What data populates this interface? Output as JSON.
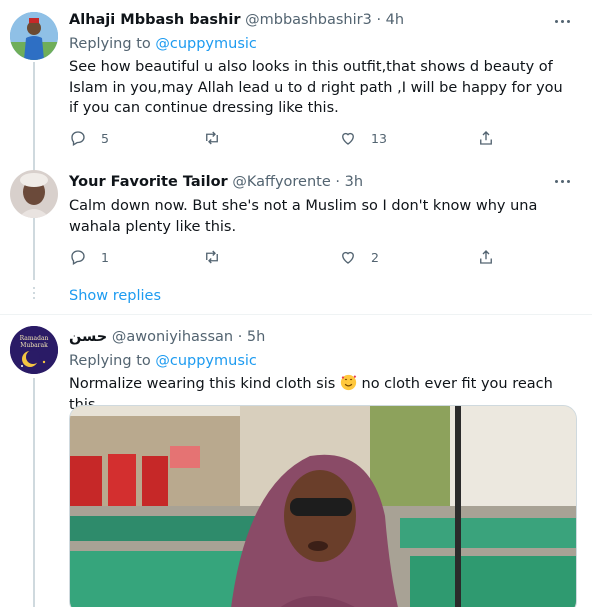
{
  "tweets": [
    {
      "name": "Alhaji Mbbash bashir",
      "handle": "@mbbashbashir3",
      "time": "· 4h",
      "replying_prefix": "Replying to",
      "replying_to": "@cuppymusic",
      "text": "See how beautiful u also looks in this outfit,that shows d beauty of Islam in you,may Allah lead u to d right path ,I will be happy for you if you can continue dressing like this.",
      "replies": "5",
      "retweets": "",
      "likes": "13"
    },
    {
      "name": "Your Favorite Tailor",
      "handle": "@Kaffyorente",
      "time": "· 3h",
      "text": "Calm down now. But she's not a Muslim so I don't know why una wahala plenty like this.",
      "replies": "1",
      "retweets": "",
      "likes": "2"
    },
    {
      "name": "حسن",
      "handle": "@awoniyihassan",
      "time": "· 5h",
      "replying_prefix": "Replying to",
      "replying_to": "@cuppymusic",
      "text_before_emoji": "Normalize wearing this kind cloth sis",
      "text_after_emoji": "no cloth ever fit you reach this",
      "avatar_text": [
        "Ramadan",
        "Mubarak"
      ]
    }
  ],
  "show_replies": "Show replies",
  "colors": {
    "accent": "#1d9bf0",
    "secondary_text": "#536471",
    "primary_text": "#0f1419",
    "divider": "#eff3f4"
  },
  "icons": [
    "reply-icon",
    "retweet-icon",
    "like-icon",
    "share-icon",
    "more-icon"
  ]
}
